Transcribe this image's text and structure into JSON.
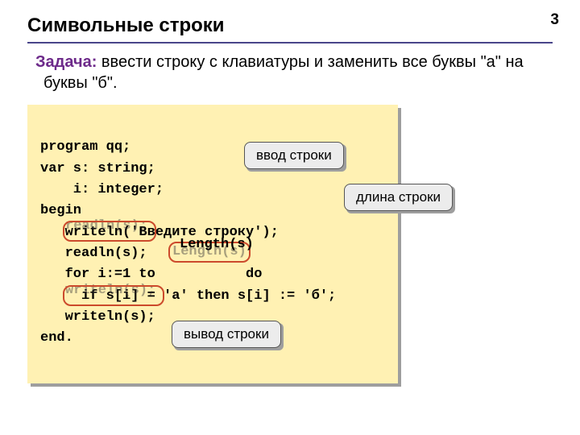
{
  "page_number": "3",
  "title": "Символьные строки",
  "task_label": "Задача:",
  "task_text": " ввести строку с клавиатуры и заменить все буквы \"а\" на буквы \"б\".",
  "code": {
    "l1": "program qq;",
    "l2": "var s: string;",
    "l3": "    i: integer;",
    "l4": "begin",
    "l5": "   writeln('Введите строку');",
    "l6_ghost": "   readln(s);",
    "l6": "   readln(s);",
    "l7a": "   for i:=1 to ",
    "l7_ghost": "Length(s)",
    "l7_overlay": "Length(s)",
    "l7b": " do",
    "l8": "     if s[i] = 'а' then s[i] := 'б';",
    "l9_ghost": "   writeln(s);",
    "l9": "   writeln(s);",
    "l10": "end."
  },
  "callouts": {
    "input": "ввод строки",
    "length": "длина строки",
    "output": "вывод строки"
  }
}
